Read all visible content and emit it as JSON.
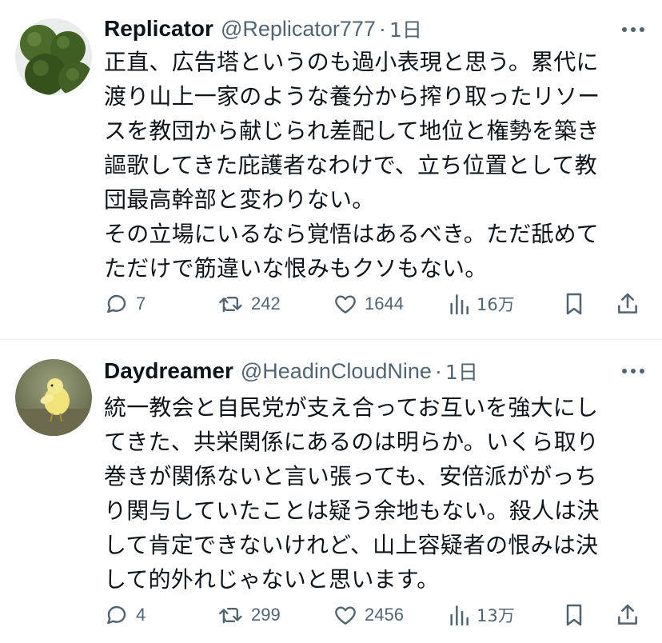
{
  "tweets": [
    {
      "display_name": "Replicator",
      "handle": "@Replicator777",
      "separator": "·",
      "time": "1日",
      "avatar": "marimo-moss-balls-avatar",
      "text_lines": [
        "正直、広告塔というのも過小表現と思う。累代に",
        "渡り山上一家のような養分から搾り取ったリソー",
        "スを教団から献じられ差配して地位と権勢を築き",
        "謳歌してきた庇護者なわけで、立ち位置として教",
        "団最高幹部と変わりない。",
        "その立場にいるなら覚悟はあるべき。ただ舐めて",
        "ただけで筋違いな恨みもクソもない。"
      ],
      "replies": "7",
      "retweets": "242",
      "likes": "1644",
      "views": "16万"
    },
    {
      "display_name": "Daydreamer",
      "handle": "@HeadinCloudNine",
      "separator": "·",
      "time": "1日",
      "avatar": "gosling-chick-avatar",
      "text_lines": [
        "統一教会と自民党が支え合ってお互いを強大にし",
        "てきた、共栄関係にあるのは明らか。いくら取り",
        "巻きが関係ないと言い張っても、安倍派ががっち",
        "り関与していたことは疑う余地もない。殺人は決",
        "して肯定できないけれど、山上容疑者の恨みは決",
        "して的外れじゃないと思います。"
      ],
      "replies": "4",
      "retweets": "299",
      "likes": "2456",
      "views": "13万"
    }
  ],
  "icons": {
    "reply": "speech-bubble-icon",
    "retweet": "repost-arrows-icon",
    "like": "heart-icon",
    "views": "bar-chart-icon",
    "bookmark": "bookmark-icon",
    "share": "share-upload-icon",
    "more": "more-dots-icon"
  },
  "colors": {
    "text_primary": "#0f1419",
    "text_secondary": "#536471",
    "divider": "#eff3f4",
    "background": "#ffffff"
  }
}
